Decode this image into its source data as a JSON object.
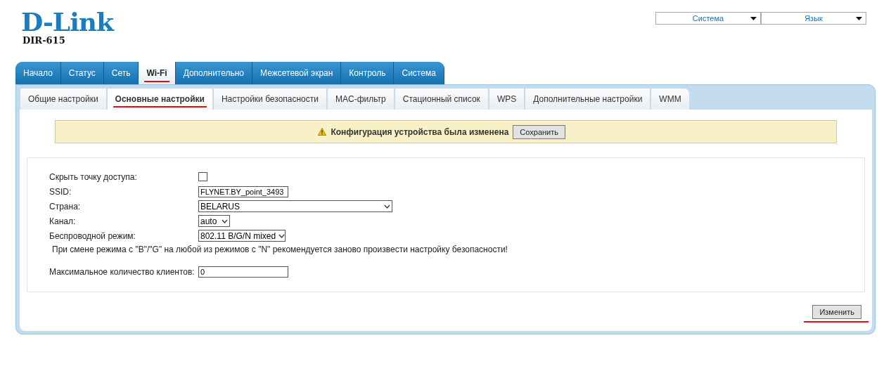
{
  "logo": {
    "brand": "D-Link",
    "model": "DIR-615"
  },
  "top_menus": [
    {
      "label": "Система"
    },
    {
      "label": "Язык"
    }
  ],
  "main_tabs": [
    {
      "label": "Начало",
      "selected": false
    },
    {
      "label": "Статус",
      "selected": false
    },
    {
      "label": "Сеть",
      "selected": false
    },
    {
      "label": "Wi-Fi",
      "selected": true
    },
    {
      "label": "Дополнительно",
      "selected": false
    },
    {
      "label": "Межсетевой экран",
      "selected": false
    },
    {
      "label": "Контроль",
      "selected": false
    },
    {
      "label": "Система",
      "selected": false
    }
  ],
  "sub_tabs": [
    {
      "label": "Общие настройки",
      "selected": false
    },
    {
      "label": "Основные настройки",
      "selected": true
    },
    {
      "label": "Настройки безопасности",
      "selected": false
    },
    {
      "label": "MAC-фильтр",
      "selected": false
    },
    {
      "label": "Стационный список",
      "selected": false
    },
    {
      "label": "WPS",
      "selected": false
    },
    {
      "label": "Дополнительные настройки",
      "selected": false
    },
    {
      "label": "WMM",
      "selected": false
    }
  ],
  "notice": {
    "text": "Конфигурация устройства была изменена",
    "button": "Сохранить"
  },
  "form": [
    {
      "kind": "checkbox",
      "label": "Скрыть точку доступа:",
      "checked": false
    },
    {
      "kind": "text",
      "label": "SSID:",
      "value": "FLYNET.BY_point_3493"
    },
    {
      "kind": "select",
      "label": "Страна:",
      "value": "BELARUS"
    },
    {
      "kind": "select",
      "label": "Канал:",
      "value": "auto"
    },
    {
      "kind": "select",
      "label": "Беспроводной режим:",
      "value": "802.11 B/G/N mixed"
    },
    {
      "kind": "note",
      "label": "При смене режима с \"B\"/\"G\" на любой из режимов с \"N\" рекомендуется заново произвести настройку безопасности!"
    },
    {
      "kind": "text",
      "label": "Максимальное количество клиентов:",
      "value": "0"
    }
  ],
  "apply_button": {
    "label": "Изменить",
    "underlined": true
  }
}
